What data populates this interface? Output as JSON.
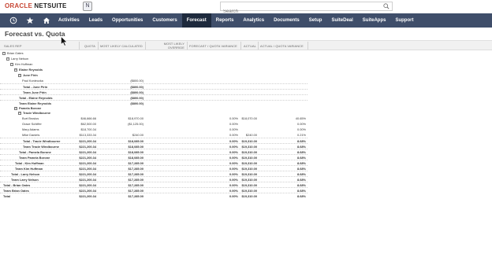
{
  "app": {
    "brand_oracle": "ORACLE",
    "brand_product": "NETSUITE",
    "badge": "N"
  },
  "search": {
    "placeholder": "Search",
    "value": ""
  },
  "nav": {
    "items": [
      "Activities",
      "Leads",
      "Opportunities",
      "Customers",
      "Forecast",
      "Reports",
      "Analytics",
      "Documents",
      "Setup",
      "SuiteDeal",
      "SuiteApps",
      "Support"
    ],
    "active": "Forecast"
  },
  "page": {
    "title": "Forecast vs. Quota"
  },
  "columns": {
    "rep": "Sales Rep",
    "quota": "Quota",
    "mlc": "Most Likely Calculated",
    "mlo": "Most Likely Override",
    "fqv": "Forecast / Quota Variance",
    "actual": "Actual",
    "aqv": "Actual / Quota Variance"
  },
  "rows": [
    {
      "label": "Brian Oates",
      "level": 0,
      "toggle": "−",
      "bold": false
    },
    {
      "label": "Larry Nelson",
      "level": 1,
      "toggle": "−",
      "bold": false
    },
    {
      "label": "Kim Huffman",
      "level": 2,
      "toggle": "−",
      "bold": false
    },
    {
      "label": "Elaine Reynolds",
      "level": 3,
      "toggle": "−",
      "bold": true
    },
    {
      "label": "June Pirin",
      "level": 4,
      "toggle": "−",
      "bold": true
    },
    {
      "label": "Paul Konieczka",
      "level": 5,
      "mlc": "($800.00)"
    },
    {
      "label": "Total - June Pirin",
      "level": 4,
      "total": true,
      "bold": true,
      "mlc": "($800.00)"
    },
    {
      "label": "Team June Pirin",
      "level": 4,
      "total": true,
      "bold": true,
      "mlc": "($800.00)"
    },
    {
      "label": "Total - Elaine Reynolds",
      "level": 3,
      "total": true,
      "bold": true,
      "mlc": "($800.00)"
    },
    {
      "label": "Team Elaine Reynolds",
      "level": 3,
      "total": true,
      "bold": true,
      "mlc": "($800.00)"
    },
    {
      "label": "Pamela Borone",
      "level": 3,
      "toggle": "−",
      "bold": true
    },
    {
      "label": "Tracie Windbourne",
      "level": 4,
      "toggle": "−",
      "bold": true
    },
    {
      "label": "Burt Brosius",
      "level": 5,
      "quota": "$46,666.66",
      "mlc": "$18,970.00",
      "fqv": "0.00%",
      "actual": "$18,070.00",
      "aqv": "40.65%"
    },
    {
      "label": "Grace Schiffer",
      "level": 5,
      "quota": "$62,500.00",
      "mlc": "($1,125.00)",
      "fqv": "0.00%",
      "actual": "",
      "aqv": "0.00%"
    },
    {
      "label": "Mary Adams",
      "level": 5,
      "quota": "$18,700.34",
      "mlc": "",
      "fqv": "0.00%",
      "actual": "",
      "aqv": "0.00%"
    },
    {
      "label": "Mike Daniels",
      "level": 5,
      "quota": "$113,333.34",
      "mlc": "$240.00",
      "fqv": "0.00%",
      "actual": "$240.00",
      "aqv": "0.21%"
    },
    {
      "label": "Total - Tracie Windbourne",
      "level": 4,
      "total": true,
      "bold": true,
      "quota": "$221,200.34",
      "mlc": "$18,085.00",
      "fqv": "0.00%",
      "actual": "$19,310.00",
      "aqv": "8.68%"
    },
    {
      "label": "Team Tracie Windbourne",
      "level": 4,
      "total": true,
      "bold": true,
      "quota": "$221,200.34",
      "mlc": "$18,085.00",
      "fqv": "0.00%",
      "actual": "$19,310.00",
      "aqv": "8.68%"
    },
    {
      "label": "Total - Pamela Borone",
      "level": 3,
      "total": true,
      "bold": true,
      "quota": "$221,200.34",
      "mlc": "$18,085.00",
      "fqv": "0.00%",
      "actual": "$19,310.00",
      "aqv": "8.68%"
    },
    {
      "label": "Team Pamela Borone",
      "level": 3,
      "total": true,
      "bold": true,
      "quota": "$221,200.34",
      "mlc": "$18,085.00",
      "fqv": "0.00%",
      "actual": "$19,310.00",
      "aqv": "8.68%"
    },
    {
      "label": "Total - Kim Huffman",
      "level": 2,
      "total": true,
      "bold": true,
      "quota": "$221,200.34",
      "mlc": "$17,285.00",
      "fqv": "0.00%",
      "actual": "$19,310.00",
      "aqv": "8.68%"
    },
    {
      "label": "Team Kim Huffman",
      "level": 2,
      "total": true,
      "bold": true,
      "quota": "$221,200.34",
      "mlc": "$17,285.00",
      "fqv": "0.00%",
      "actual": "$19,310.00",
      "aqv": "8.68%"
    },
    {
      "label": "Total - Larry Nelson",
      "level": 1,
      "total": true,
      "bold": true,
      "quota": "$221,200.34",
      "mlc": "$17,285.00",
      "fqv": "0.00%",
      "actual": "$19,310.00",
      "aqv": "8.68%"
    },
    {
      "label": "Team Larry Nelson",
      "level": 1,
      "total": true,
      "bold": true,
      "quota": "$221,200.34",
      "mlc": "$17,285.00",
      "fqv": "0.00%",
      "actual": "$19,310.00",
      "aqv": "8.68%"
    },
    {
      "label": "Total - Brian Oates",
      "level": 0,
      "total": true,
      "bold": true,
      "quota": "$221,200.34",
      "mlc": "$17,285.00",
      "fqv": "0.00%",
      "actual": "$19,310.00",
      "aqv": "8.68%"
    },
    {
      "label": "Team Brian Oates",
      "level": 0,
      "total": true,
      "bold": true,
      "quota": "$221,200.34",
      "mlc": "$17,285.00",
      "fqv": "0.00%",
      "actual": "$19,310.00",
      "aqv": "8.68%"
    },
    {
      "label": "Total",
      "level": 0,
      "total": true,
      "bold": true,
      "quota": "$221,200.34",
      "mlc": "$17,285.00",
      "fqv": "0.00%",
      "actual": "$19,310.00",
      "aqv": "8.68%"
    }
  ],
  "colors": {
    "nav_bg": "#3f4e6a",
    "nav_active": "#1e2a3d",
    "oracle_red": "#c74634"
  },
  "icons": {
    "nav": [
      "recent-icon",
      "star-icon",
      "home-icon"
    ],
    "search": "search-icon"
  }
}
